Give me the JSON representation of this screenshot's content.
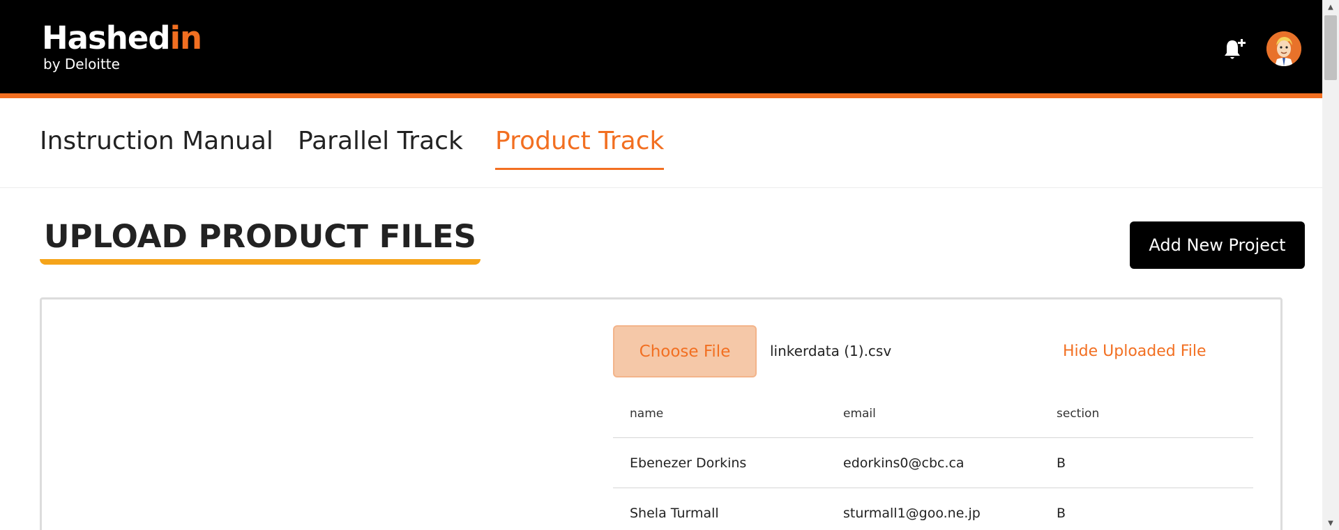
{
  "header": {
    "logo_main_prefix": "Hashed",
    "logo_main_accent": "in",
    "logo_sub": "by Deloitte",
    "bell_icon": "notification-bell-plus-icon",
    "avatar_icon": "user-avatar"
  },
  "tabs": [
    {
      "label": "Instruction Manual",
      "active": false
    },
    {
      "label": "Parallel Track",
      "active": false
    },
    {
      "label": "Product Track",
      "active": true
    }
  ],
  "section": {
    "title": "UPLOAD PRODUCT FILES",
    "add_button": "Add New Project"
  },
  "upload": {
    "choose_button": "Choose File",
    "file_name": "linkerdata (1).csv",
    "hide_link": "Hide Uploaded File"
  },
  "table": {
    "columns": [
      "name",
      "email",
      "section"
    ],
    "rows": [
      [
        "Ebenezer Dorkins",
        "edorkins0@cbc.ca",
        "B"
      ],
      [
        "Shela Turmall",
        "sturmall1@goo.ne.jp",
        "B"
      ]
    ]
  },
  "colors": {
    "brand_orange": "#f26f21",
    "heading_underline": "#f5a41a",
    "header_bg": "#000000"
  }
}
